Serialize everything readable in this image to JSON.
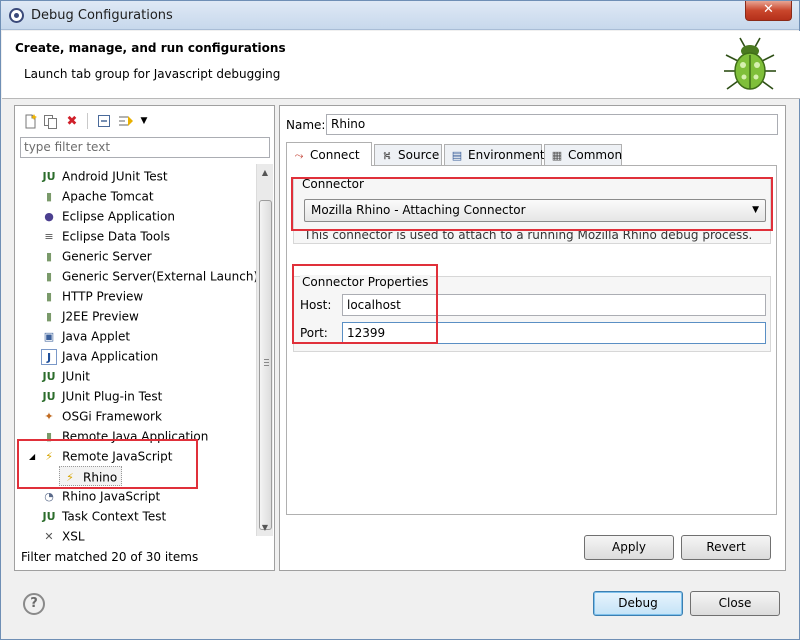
{
  "window": {
    "title": "Debug Configurations",
    "close_glyph": "✕"
  },
  "banner": {
    "heading": "Create, manage, and run configurations",
    "description": "Launch tab group for Javascript debugging"
  },
  "toolbar": {
    "new": "new-configuration-icon",
    "duplicate": "duplicate-icon",
    "delete": "delete-icon",
    "collapse": "collapse-all-icon",
    "filter": "filter-icon"
  },
  "filter": {
    "placeholder": "type filter text"
  },
  "tree": {
    "items": [
      {
        "label": "Android JUnit Test",
        "icon": "JU"
      },
      {
        "label": "Apache Tomcat",
        "icon": "▮"
      },
      {
        "label": "Eclipse Application",
        "icon": "●"
      },
      {
        "label": "Eclipse Data Tools",
        "icon": "≡"
      },
      {
        "label": "Generic Server",
        "icon": "▮"
      },
      {
        "label": "Generic Server(External Launch)",
        "icon": "▮"
      },
      {
        "label": "HTTP Preview",
        "icon": "▮"
      },
      {
        "label": "J2EE Preview",
        "icon": "▮"
      },
      {
        "label": "Java Applet",
        "icon": "▣"
      },
      {
        "label": "Java Application",
        "icon": "J"
      },
      {
        "label": "JUnit",
        "icon": "JU"
      },
      {
        "label": "JUnit Plug-in Test",
        "icon": "JU"
      },
      {
        "label": "OSGi Framework",
        "icon": "✦"
      },
      {
        "label": "Remote Java Application",
        "icon": "▮"
      },
      {
        "label": "Remote JavaScript",
        "icon": "⚡",
        "expanded": true
      },
      {
        "label": "Rhino",
        "icon": "⚡",
        "child": true,
        "selected": true
      },
      {
        "label": "Rhino JavaScript",
        "icon": "◔"
      },
      {
        "label": "Task Context Test",
        "icon": "JU"
      },
      {
        "label": "XSL",
        "icon": "✕"
      }
    ]
  },
  "status": {
    "filter_text": "Filter matched 20 of 30 items"
  },
  "config": {
    "name_label": "Name:",
    "name_value": "Rhino",
    "tabs": [
      {
        "label": "Connect",
        "icon": "connect-icon",
        "active": true
      },
      {
        "label": "Source",
        "icon": "source-icon"
      },
      {
        "label": "Environment",
        "icon": "environment-icon"
      },
      {
        "label": "Common",
        "icon": "common-icon"
      }
    ],
    "connector": {
      "group_label": "Connector",
      "selected": "Mozilla Rhino - Attaching Connector",
      "description": "This connector is used to attach to a running Mozilla Rhino debug process."
    },
    "properties": {
      "group_label": "Connector Properties",
      "host_label": "Host:",
      "host_value": "localhost",
      "port_label": "Port:",
      "port_value": "12399"
    },
    "apply_label": "Apply",
    "revert_label": "Revert"
  },
  "footer": {
    "help_glyph": "?",
    "debug_label": "Debug",
    "close_label": "Close"
  },
  "colors": {
    "highlight": "#e0303a",
    "accent": "#3c7fb1"
  }
}
